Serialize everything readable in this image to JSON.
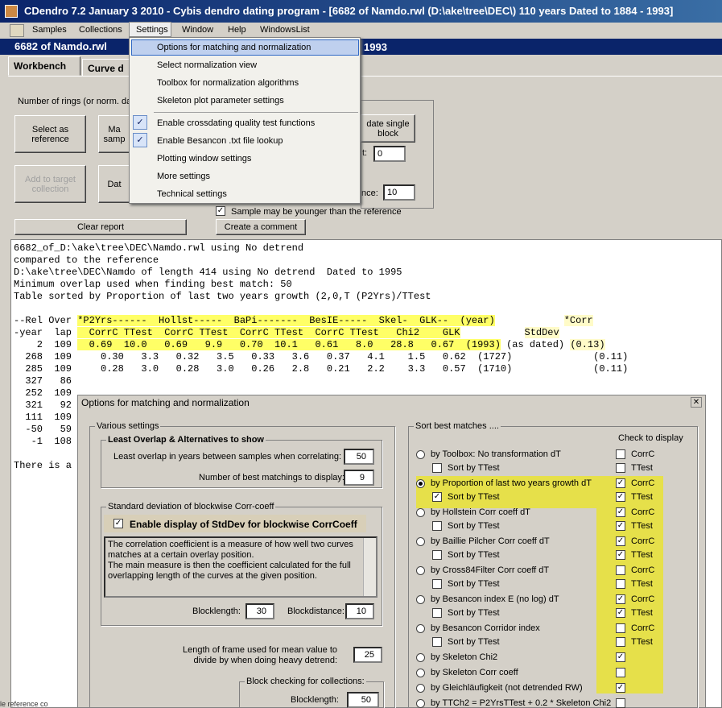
{
  "window": {
    "title": "CDendro 7.2  January 3 2010 - Cybis dendro dating program - [6682 of Namdo.rwl    (D:\\ake\\tree\\DEC\\)  110 years  Dated to 1884 - 1993]"
  },
  "menubar": [
    "Samples",
    "Collections",
    "Settings",
    "Window",
    "Help",
    "WindowsList"
  ],
  "doc": {
    "title": "6682 of Namdo.rwl",
    "title_right": "1993"
  },
  "tabs": [
    "Workbench",
    "Curve d"
  ],
  "workbench": {
    "rings_label": "Number of rings (or norm. dat",
    "btn_select_ref": "Select as\nreference",
    "btn_match": "Ma\nsamp",
    "btn_add_target": "Add to target\ncollection",
    "btn_dat": "Dat",
    "btn_single": "date single\nblock",
    "field_t_label": "t:",
    "field_t_value": "0",
    "field_nce_label": "nce:",
    "field_nce_value": "10",
    "younger_label": "Sample may be younger than the reference",
    "btn_clear": "Clear report",
    "btn_comment": "Create a comment"
  },
  "settings_menu": {
    "items": [
      "Options for matching and normalization",
      "Select normalization view",
      "Toolbox for normalization algorithms",
      "Skeleton plot parameter settings",
      "Enable crossdating quality test functions",
      "Enable Besancon .txt file lookup",
      "Plotting window settings",
      "More settings",
      "Technical settings"
    ],
    "checkmark": "✓"
  },
  "report": {
    "lines": [
      "6682_of_D:\\ake\\tree\\DEC\\Namdo.rwl using No detrend",
      "compared to the reference",
      "D:\\ake\\tree\\DEC\\Namdo of length 414 using No detrend  Dated to 1995",
      "Minimum overlap used when finding best match: 50",
      "",
      "Table sorted by Proportion of last two years growth (2,0,T (P2Yrs)/TTest"
    ],
    "header1_a": "--Rel Over ",
    "header1_b": "*P2Yrs------  Hollst-----  BaPi-------  BesIE-----  Skel-  GLK--  (year)",
    "header1_c": "*Corr",
    "header2_a": "-year  lap ",
    "header2_b": "  CorrC TTest  CorrC TTest  CorrC TTest  CorrC TTest   Chi2    GLK",
    "header2_c": "StdDev",
    "row_best_a": "    2  109 ",
    "row_best_b": "  0.69  10.0   0.69   9.9   0.70  10.1   0.61   8.0   28.8   0.67  (1993)",
    "row_best_mid": " (as dated) ",
    "row_best_c": "(0.13)",
    "rows": [
      "  268  109     0.30   3.3   0.32   3.5   0.33   3.6   0.37   4.1    1.5   0.62  (1727)              (0.11)",
      "  285  109     0.28   3.0   0.28   3.0   0.26   2.8   0.21   2.2    3.3   0.57  (1710)              (0.11)",
      "  327   86",
      "  252  109",
      "  321   92",
      "  111  109",
      "  -50   59",
      "   -1  108"
    ],
    "footer": "There is a r"
  },
  "dialog": {
    "title": "Options for matching and normalization",
    "close": "✕",
    "various": "Various settings",
    "least_overlap_header": "Least Overlap &  Alternatives to show",
    "least_overlap_label": "Least overlap in years between samples when correlating:",
    "least_overlap_value": "50",
    "best_matchings_label": "Number of best matchings to display:",
    "best_matchings_value": "9",
    "stddev_group": "Standard deviation of blockwise Corr-coeff",
    "enable_stddev": "Enable display of StdDev for blockwise CorrCoeff",
    "description": "The correlation coefficient is a measure of how well two curves matches at a certain overlay position.\nThe main measure is then the coefficient calculated for the full overlapping length of the curves at the given position.",
    "blocklength_label": "Blocklength:",
    "blocklength_value": "30",
    "blockdistance_label": "Blockdistance:",
    "blockdistance_value": "10",
    "frame_label": "Length of frame used for mean value to\ndivide by when doing heavy detrend:",
    "frame_value": "25",
    "block_checking": "Block checking for collections:",
    "blocklength2_label": "Blocklength:",
    "blocklength2_value": "50",
    "sort_group": "Sort best matches ....",
    "check_to_display": "Check to display",
    "sort_by_ttest": "Sort by TTest",
    "corrc": "CorrC",
    "ttest": "TTest",
    "methods": [
      "by Toolbox: No transformation  dT",
      "by Proportion of last two years growth  dT",
      "by Hollstein Corr coeff  dT",
      "by Baillie Pilcher Corr coeff  dT",
      "by Cross84Filter Corr coeff  dT",
      "by Besancon index E (no log)  dT",
      "by Besancon Corridor index",
      "by Skeleton Chi2",
      "by Skeleton Corr coeff",
      "by Gleichläufigkeit (not detrended RW)",
      "by TTCh2 = P2YrsTTest + 0.2 * Skeleton Chi2"
    ]
  },
  "status": {
    "left": "le reference co"
  }
}
